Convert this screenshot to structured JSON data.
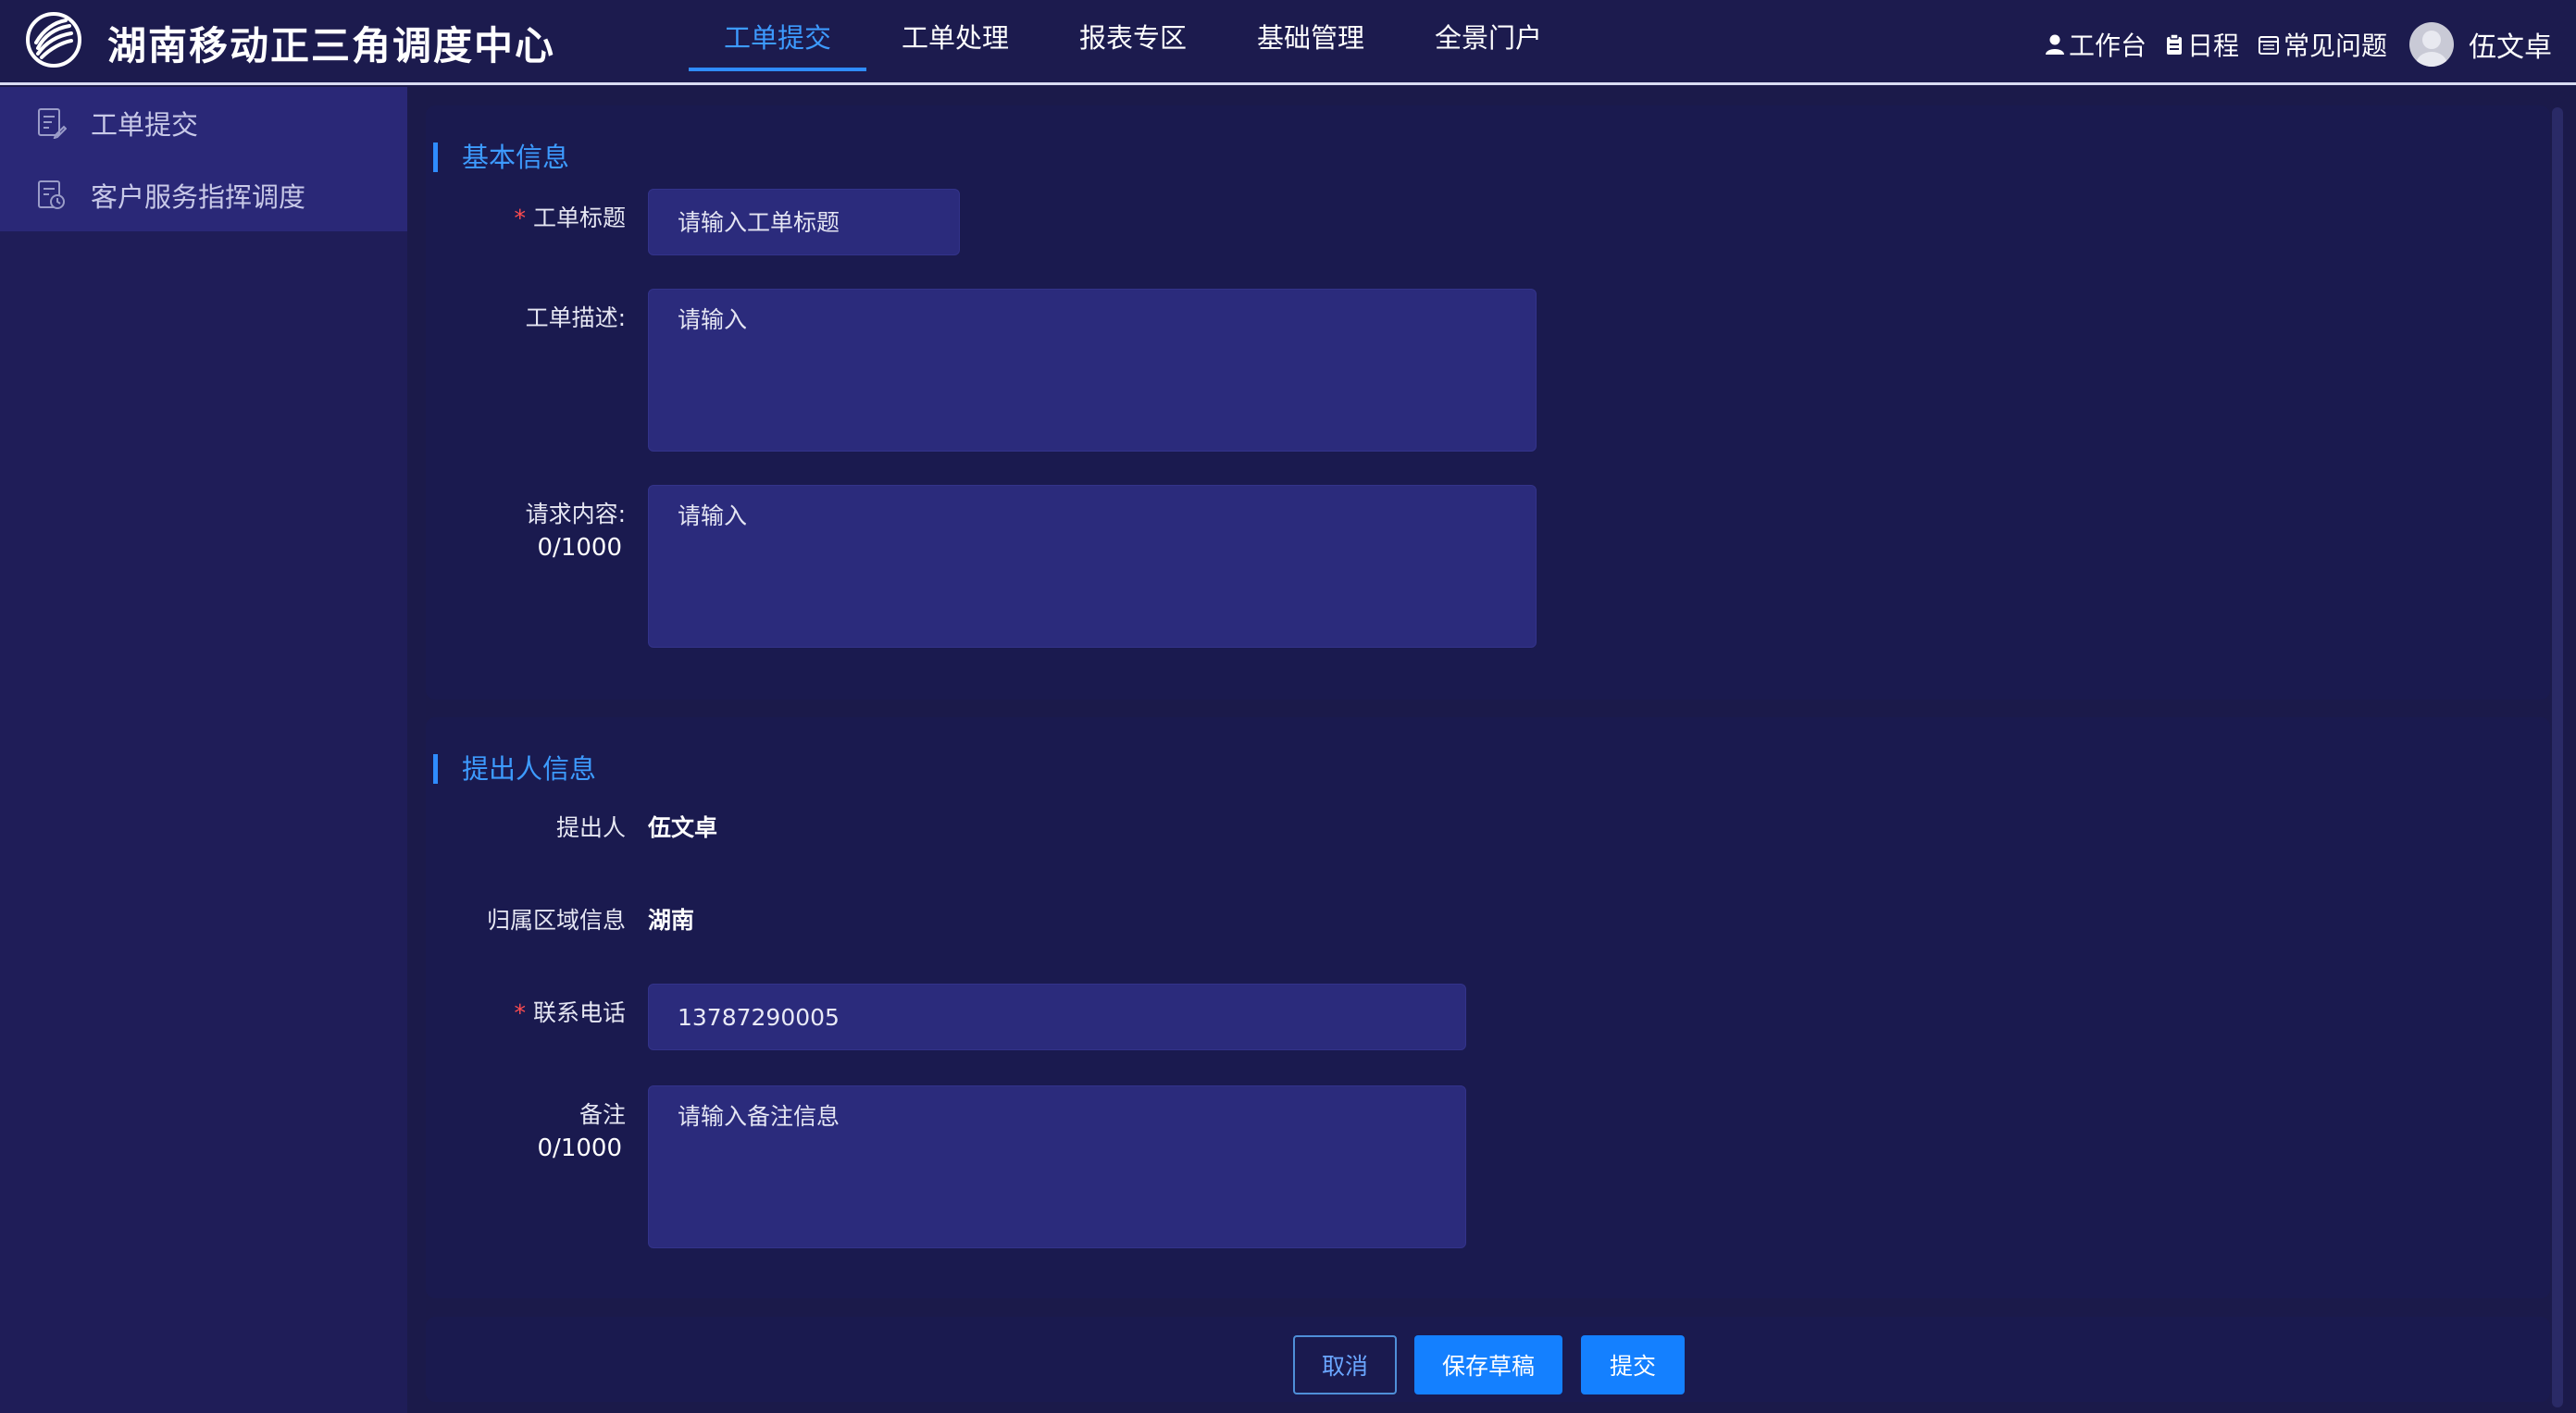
{
  "header": {
    "logo_icon": "china-mobile-logo-icon",
    "app_title": "湖南移动正三角调度中心",
    "nav": [
      {
        "label": "工单提交",
        "active": true
      },
      {
        "label": "工单处理",
        "active": false
      },
      {
        "label": "报表专区",
        "active": false
      },
      {
        "label": "基础管理",
        "active": false
      },
      {
        "label": "全景门户",
        "active": false
      }
    ],
    "links": {
      "workbench": "工作台",
      "schedule": "日程",
      "faq": "常见问题"
    },
    "username": "伍文卓"
  },
  "sidebar": {
    "items": [
      {
        "label": "工单提交",
        "icon": "form-edit-icon"
      },
      {
        "label": "客户服务指挥调度",
        "icon": "dispatch-clock-icon"
      }
    ]
  },
  "basic_info": {
    "title": "基本信息",
    "ticket_title_label": "工单标题",
    "ticket_title_placeholder": "请输入工单标题",
    "description_label": "工单描述:",
    "description_placeholder": "请输入",
    "request_label": "请求内容:",
    "request_counter": "0/1000",
    "request_placeholder": "请输入"
  },
  "proposer_info": {
    "title": "提出人信息",
    "proposer_label": "提出人",
    "proposer_value": "伍文卓",
    "region_label": "归属区域信息",
    "region_value": "湖南",
    "phone_label": "联系电话",
    "phone_value": "13787290005",
    "remark_label": "备注",
    "remark_counter": "0/1000",
    "remark_placeholder": "请输入备注信息"
  },
  "actions": {
    "cancel": "取消",
    "save_draft": "保存草稿",
    "submit": "提交"
  },
  "colors": {
    "accent": "#1480ff",
    "active_nav": "#3d9bff",
    "required": "#ff4d4f",
    "background": "#1b1a4a"
  }
}
